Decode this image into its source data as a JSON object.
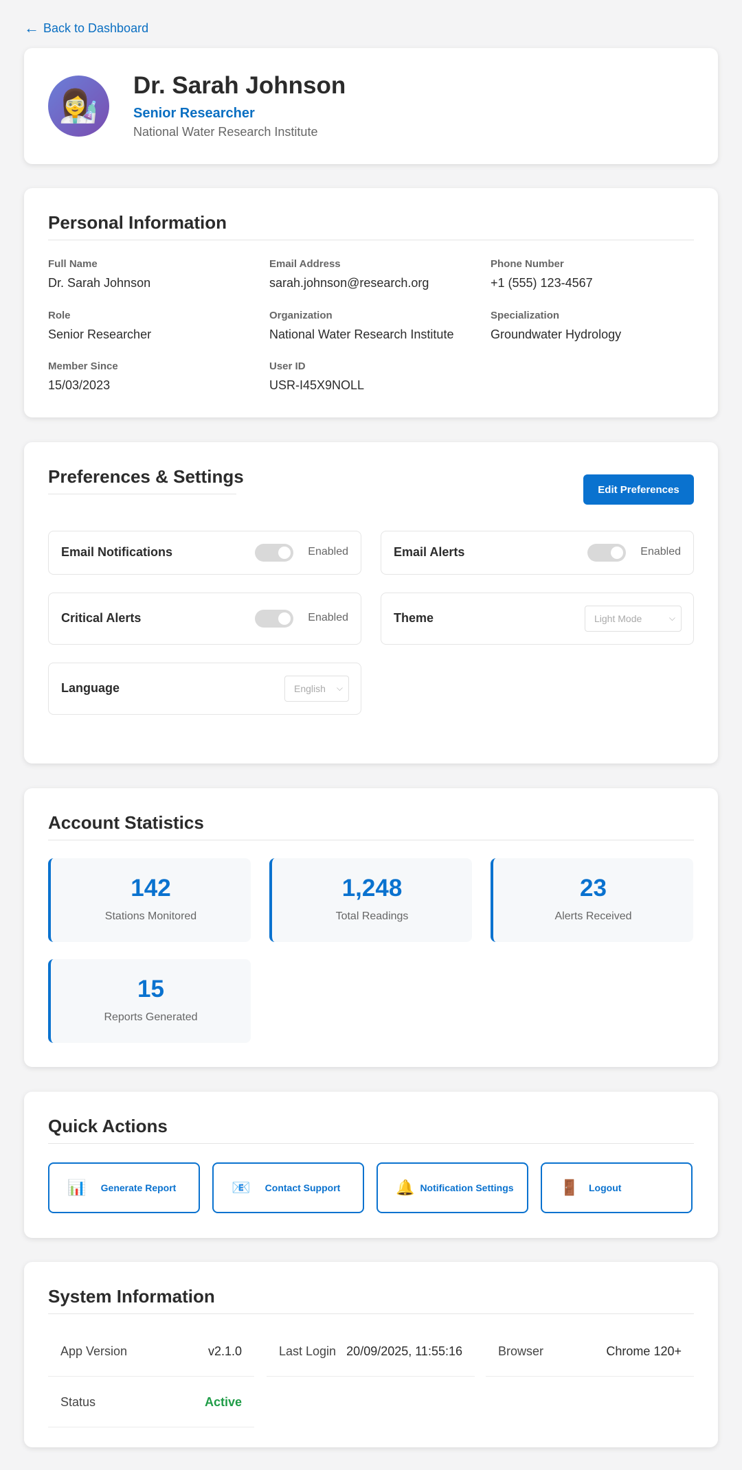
{
  "nav": {
    "back_label": "Back to Dashboard",
    "back_icon": "arrow-left-icon"
  },
  "profile": {
    "avatar_icon": "scientist-avatar-icon",
    "avatar_glyph": "👩‍🔬",
    "name": "Dr. Sarah Johnson",
    "role": "Senior Researcher",
    "organization": "National Water Research Institute"
  },
  "personal": {
    "title": "Personal Information",
    "fields": [
      {
        "label": "Full Name",
        "value": "Dr. Sarah Johnson"
      },
      {
        "label": "Email Address",
        "value": "sarah.johnson@research.org"
      },
      {
        "label": "Phone Number",
        "value": "+1 (555) 123-4567"
      },
      {
        "label": "Role",
        "value": "Senior Researcher"
      },
      {
        "label": "Organization",
        "value": "National Water Research Institute"
      },
      {
        "label": "Specialization",
        "value": "Groundwater Hydrology"
      },
      {
        "label": "Member Since",
        "value": "15/03/2023"
      },
      {
        "label": "User ID",
        "value": "USR-I45X9NOLL"
      }
    ]
  },
  "preferences": {
    "title": "Preferences & Settings",
    "edit_label": "Edit Preferences",
    "toggles": [
      {
        "label": "Email Notifications",
        "state": "Enabled"
      },
      {
        "label": "Email Alerts",
        "state": "Enabled"
      },
      {
        "label": "Critical Alerts",
        "state": "Enabled"
      }
    ],
    "theme": {
      "label": "Theme",
      "value": "Light Mode"
    },
    "language": {
      "label": "Language",
      "value": "English"
    }
  },
  "stats": {
    "title": "Account Statistics",
    "items": [
      {
        "value": "142",
        "label": "Stations Monitored"
      },
      {
        "value": "1,248",
        "label": "Total Readings"
      },
      {
        "value": "23",
        "label": "Alerts Received"
      },
      {
        "value": "15",
        "label": "Reports Generated"
      }
    ]
  },
  "actions": {
    "title": "Quick Actions",
    "items": [
      {
        "label": "Generate Report",
        "icon": "bar-chart-icon",
        "glyph": "📊"
      },
      {
        "label": "Contact Support",
        "icon": "envelope-icon",
        "glyph": "📧"
      },
      {
        "label": "Notification Settings",
        "icon": "bell-icon",
        "glyph": "🔔"
      },
      {
        "label": "Logout",
        "icon": "door-icon",
        "glyph": "🚪"
      }
    ]
  },
  "system": {
    "title": "System Information",
    "rows": [
      {
        "label": "App Version",
        "value": "v2.1.0"
      },
      {
        "label": "Last Login",
        "value": "20/09/2025, 11:55:16"
      },
      {
        "label": "Browser",
        "value": "Chrome 120+"
      },
      {
        "label": "Status",
        "value": "Active"
      }
    ]
  },
  "colors": {
    "accent": "#0a72cf",
    "status_active": "#1f9c47",
    "background": "#f4f4f5"
  }
}
